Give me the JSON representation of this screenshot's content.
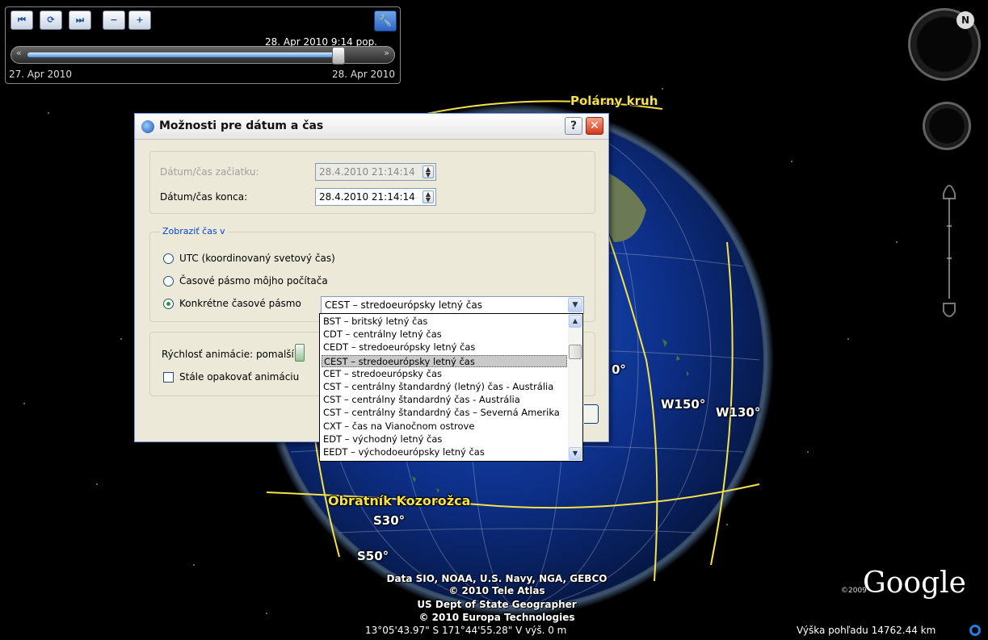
{
  "time_slider": {
    "current_datetime": "28. Apr 2010  9:14 pop.",
    "start_label": "27. Apr 2010",
    "end_label": "28. Apr 2010",
    "position_fraction": 0.93,
    "buttons": [
      "⏮",
      "⟳",
      "⏭",
      "−",
      "+"
    ]
  },
  "map_labels": {
    "arctic_circle": "Polárny kruh",
    "tropic_capricorn": "Obratník Kozorožca",
    "w150": "W150°",
    "w130": "W130°",
    "s30": "S30°",
    "s50": "S50°",
    "partial_degree": "0°"
  },
  "attribution": {
    "line1": "Data SIO, NOAA, U.S. Navy, NGA, GEBCO",
    "line2": "© 2010 Tele Atlas",
    "line3": "US Dept of State Geographer",
    "line4": "© 2010 Europa Technologies"
  },
  "status": {
    "coordinates": "13°05'43.97\" S   171°44'55.28\" V  výš.   0 m",
    "altitude": "Výška pohľadu 14762.44 km"
  },
  "brand": {
    "google": "Google",
    "year": "©2009"
  },
  "dialog": {
    "title": "Možnosti pre dátum a čas",
    "help": "?",
    "close": "✕",
    "start_label": "Dátum/čas začiatku:",
    "start_value": "28.4.2010 21:14:14",
    "end_label": "Dátum/čas konca:",
    "end_value": "28.4.2010 21:14:14",
    "show_time_legend": "Zobraziť čas v",
    "radio_utc": "UTC (koordinovaný svetový čas)",
    "radio_local": "Časové pásmo môjho počítača",
    "radio_specific": "Konkrétne časové pásmo",
    "selected_radio": "radio_specific",
    "tz_selected": "CEST – stredoeurópsky letný čas",
    "speed_label": "Rýchlosť animácie:  pomalší",
    "repeat_label": "Stále opakovať animáciu",
    "repeat_checked": false
  },
  "tz_options": [
    "BST – britský letný čas",
    "CDT – centrálny letný čas",
    "CEDT – stredoeurópsky letný čas",
    "CEST – stredoeurópsky letný čas",
    "CET – stredoeurópsky čas",
    "CST – centrálny štandardný (letný) čas - Austrália",
    "CST – centrálny štandardný čas - Austrália",
    "CST – centrálny štandardný čas – Severná Amerika",
    "CXT – čas na Vianočnom ostrove",
    "EDT – východný letný čas",
    "EEDT – východoeurópsky letný čas"
  ],
  "tz_selected_index": 3,
  "colors": {
    "accent": "#0046d5",
    "map_label": "#f5e14a",
    "globe_ocean": "#0c2d7a"
  },
  "north_indicator": "N"
}
